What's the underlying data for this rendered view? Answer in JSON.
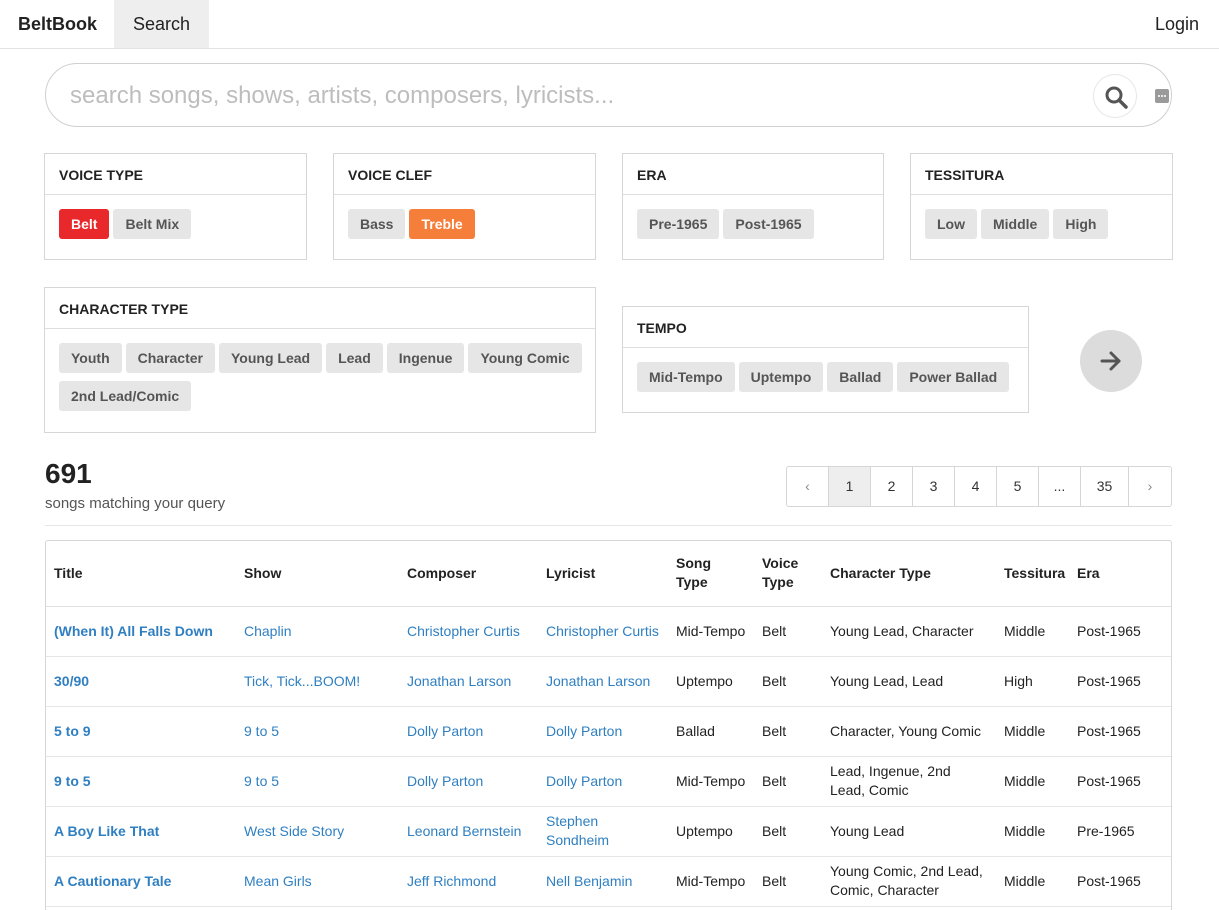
{
  "nav": {
    "brand": "BeltBook",
    "search": "Search",
    "login": "Login"
  },
  "search": {
    "placeholder": "search songs, shows, artists, composers, lyricists...",
    "value": ""
  },
  "filters": {
    "voice_type": {
      "title": "VOICE TYPE",
      "options": [
        "Belt",
        "Belt Mix"
      ],
      "selected": "Belt"
    },
    "voice_clef": {
      "title": "VOICE CLEF",
      "options": [
        "Bass",
        "Treble"
      ],
      "selected": "Treble"
    },
    "era": {
      "title": "ERA",
      "options": [
        "Pre-1965",
        "Post-1965"
      ]
    },
    "tessitura": {
      "title": "TESSITURA",
      "options": [
        "Low",
        "Middle",
        "High"
      ]
    },
    "character_type": {
      "title": "CHARACTER TYPE",
      "options": [
        "Youth",
        "Character",
        "Young Lead",
        "Lead",
        "Ingenue",
        "Young Comic",
        "2nd Lead/Comic"
      ]
    },
    "tempo": {
      "title": "TEMPO",
      "options": [
        "Mid-Tempo",
        "Uptempo",
        "Ballad",
        "Power Ballad"
      ]
    }
  },
  "results": {
    "count": "691",
    "label": "songs matching your query"
  },
  "pagination": {
    "prev": "‹",
    "pages": [
      "1",
      "2",
      "3",
      "4",
      "5",
      "...",
      "35"
    ],
    "next": "›",
    "current": "1"
  },
  "table": {
    "columns": [
      "Title",
      "Show",
      "Composer",
      "Lyricist",
      "Song Type",
      "Voice Type",
      "Character Type",
      "Tessitura",
      "Era"
    ],
    "rows": [
      [
        "(When It) All Falls Down",
        "Chaplin",
        "Christopher Curtis",
        "Christopher Curtis",
        "Mid-Tempo",
        "Belt",
        "Young Lead, Character",
        "Middle",
        "Post-1965"
      ],
      [
        "30/90",
        "Tick, Tick...BOOM!",
        "Jonathan Larson",
        "Jonathan Larson",
        "Uptempo",
        "Belt",
        "Young Lead, Lead",
        "High",
        "Post-1965"
      ],
      [
        "5 to 9",
        "9 to 5",
        "Dolly Parton",
        "Dolly Parton",
        "Ballad",
        "Belt",
        "Character, Young Comic",
        "Middle",
        "Post-1965"
      ],
      [
        "9 to 5",
        "9 to 5",
        "Dolly Parton",
        "Dolly Parton",
        "Mid-Tempo",
        "Belt",
        "Lead, Ingenue, 2nd Lead, Comic",
        "Middle",
        "Post-1965"
      ],
      [
        "A Boy Like That",
        "West Side Story",
        "Leonard Bernstein",
        "Stephen Sondheim",
        "Uptempo",
        "Belt",
        "Young Lead",
        "Middle",
        "Pre-1965"
      ],
      [
        "A Cautionary Tale",
        "Mean Girls",
        "Jeff Richmond",
        "Nell Benjamin",
        "Mid-Tempo",
        "Belt",
        "Young Comic, 2nd Lead, Comic, Character",
        "Middle",
        "Post-1965"
      ]
    ]
  },
  "colors": {
    "selected_voice_type": "#e8282b",
    "selected_clef": "#f57e3a",
    "link": "#2f7fc1"
  },
  "icons": {
    "search": "search-icon",
    "more": "more-icon",
    "go": "arrow-right-icon"
  }
}
